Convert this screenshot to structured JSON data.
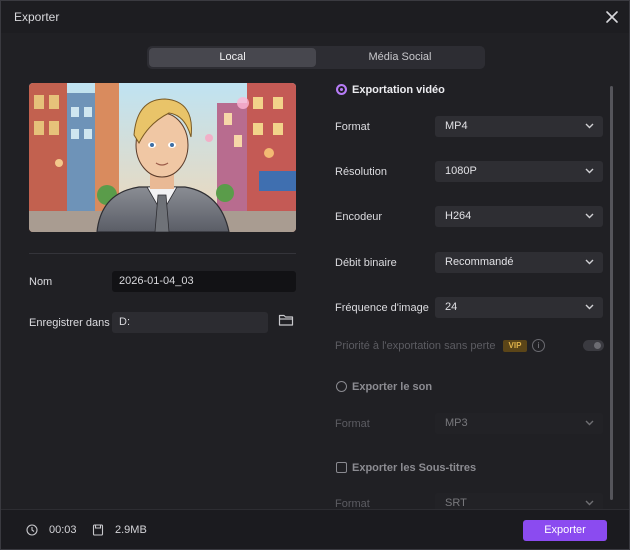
{
  "window": {
    "title": "Exporter"
  },
  "tabs": [
    {
      "label": "Local",
      "active": true
    },
    {
      "label": "Média Social",
      "active": false
    }
  ],
  "left": {
    "name_label": "Nom",
    "name_value": "2026-01-04_03",
    "save_label": "Enregistrer dans",
    "save_value": "D:"
  },
  "video": {
    "header": "Exportation vidéo",
    "format_label": "Format",
    "format_value": "MP4",
    "resolution_label": "Résolution",
    "resolution_value": "1080P",
    "encoder_label": "Encodeur",
    "encoder_value": "H264",
    "bitrate_label": "Débit binaire",
    "bitrate_value": "Recommandé",
    "framerate_label": "Fréquence d'image",
    "framerate_value": "24",
    "lossless_label": "Priorité à l'exportation sans perte",
    "vip_badge": "VIP",
    "info_icon": "i"
  },
  "audio": {
    "header": "Exporter le son",
    "format_label": "Format",
    "format_value": "MP3"
  },
  "subtitles": {
    "header": "Exporter les Sous-titres",
    "format_label": "Format",
    "format_value": "SRT"
  },
  "footer": {
    "duration": "00:03",
    "size": "2.9MB",
    "export_label": "Exporter"
  },
  "colors": {
    "accent": "#8b4bf0",
    "radio_on": "#b77cf7",
    "vip": "#e0b34a"
  }
}
